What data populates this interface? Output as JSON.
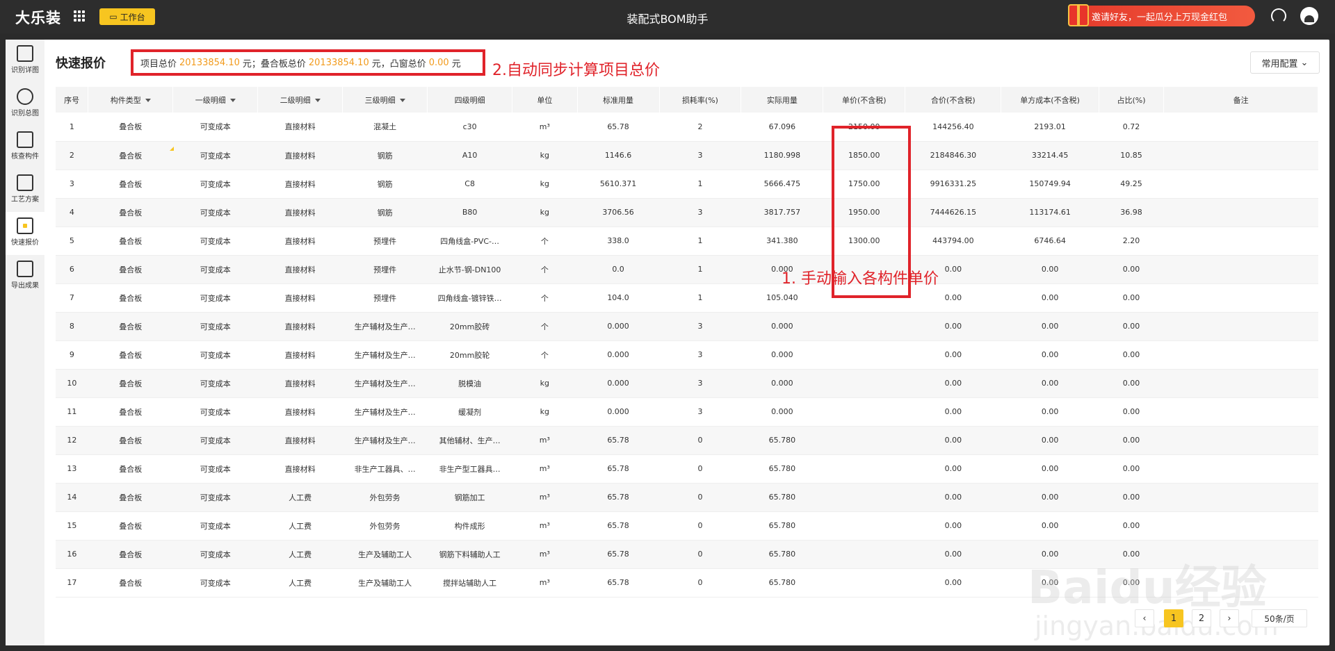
{
  "topbar": {
    "logo": "大乐装",
    "workbench_label": "工作台",
    "app_title": "装配式BOM助手",
    "invite_text": "邀请好友，一起瓜分上万现金红包"
  },
  "sidebar": {
    "items": [
      {
        "label": "识别详图"
      },
      {
        "label": "识别总图"
      },
      {
        "label": "核查构件"
      },
      {
        "label": "工艺方案"
      },
      {
        "label": "快速报价"
      },
      {
        "label": "导出成果"
      }
    ]
  },
  "header": {
    "title": "快速报价",
    "totals": {
      "project_label": "项目总价",
      "project_total": "20133854.10",
      "unit1": "元；叠合板总价",
      "slab_total": "20133854.10",
      "unit2": "元，凸窗总价",
      "window_total": "0.00",
      "unit3": "元"
    },
    "config_label": "常用配置"
  },
  "annotations": {
    "note_auto": "2.自动同步计算项目总价",
    "note_manual": "1. 手动输入各构件单价"
  },
  "table": {
    "columns": [
      "序号",
      "构件类型",
      "一级明细",
      "二级明细",
      "三级明细",
      "四级明细",
      "单位",
      "标准用量",
      "损耗率(%)",
      "实际用量",
      "单价(不含税)",
      "合价(不含税)",
      "单方成本(不含税)",
      "占比(%)",
      "备注"
    ],
    "rows": [
      [
        "1",
        "叠合板",
        "可变成本",
        "直接材料",
        "混凝土",
        "c30",
        "m³",
        "65.78",
        "2",
        "67.096",
        "2150.00",
        "144256.40",
        "2193.01",
        "0.72",
        ""
      ],
      [
        "2",
        "叠合板",
        "可变成本",
        "直接材料",
        "钢筋",
        "A10",
        "kg",
        "1146.6",
        "3",
        "1180.998",
        "1850.00",
        "2184846.30",
        "33214.45",
        "10.85",
        ""
      ],
      [
        "3",
        "叠合板",
        "可变成本",
        "直接材料",
        "钢筋",
        "C8",
        "kg",
        "5610.371",
        "1",
        "5666.475",
        "1750.00",
        "9916331.25",
        "150749.94",
        "49.25",
        ""
      ],
      [
        "4",
        "叠合板",
        "可变成本",
        "直接材料",
        "钢筋",
        "B80",
        "kg",
        "3706.56",
        "3",
        "3817.757",
        "1950.00",
        "7444626.15",
        "113174.61",
        "36.98",
        ""
      ],
      [
        "5",
        "叠合板",
        "可变成本",
        "直接材料",
        "预埋件",
        "四角线盒-PVC-…",
        "个",
        "338.0",
        "1",
        "341.380",
        "1300.00",
        "443794.00",
        "6746.64",
        "2.20",
        ""
      ],
      [
        "6",
        "叠合板",
        "可变成本",
        "直接材料",
        "预埋件",
        "止水节-钢-DN100",
        "个",
        "0.0",
        "1",
        "0.000",
        "",
        "0.00",
        "0.00",
        "0.00",
        ""
      ],
      [
        "7",
        "叠合板",
        "可变成本",
        "直接材料",
        "预埋件",
        "四角线盒-镀锌铁…",
        "个",
        "104.0",
        "1",
        "105.040",
        "",
        "0.00",
        "0.00",
        "0.00",
        ""
      ],
      [
        "8",
        "叠合板",
        "可变成本",
        "直接材料",
        "生产辅材及生产…",
        "20mm胶砖",
        "个",
        "0.000",
        "3",
        "0.000",
        "",
        "0.00",
        "0.00",
        "0.00",
        ""
      ],
      [
        "9",
        "叠合板",
        "可变成本",
        "直接材料",
        "生产辅材及生产…",
        "20mm胶轮",
        "个",
        "0.000",
        "3",
        "0.000",
        "",
        "0.00",
        "0.00",
        "0.00",
        ""
      ],
      [
        "10",
        "叠合板",
        "可变成本",
        "直接材料",
        "生产辅材及生产…",
        "脱模油",
        "kg",
        "0.000",
        "3",
        "0.000",
        "",
        "0.00",
        "0.00",
        "0.00",
        ""
      ],
      [
        "11",
        "叠合板",
        "可变成本",
        "直接材料",
        "生产辅材及生产…",
        "缓凝剂",
        "kg",
        "0.000",
        "3",
        "0.000",
        "",
        "0.00",
        "0.00",
        "0.00",
        ""
      ],
      [
        "12",
        "叠合板",
        "可变成本",
        "直接材料",
        "生产辅材及生产…",
        "其他辅材、生产…",
        "m³",
        "65.78",
        "0",
        "65.780",
        "",
        "0.00",
        "0.00",
        "0.00",
        ""
      ],
      [
        "13",
        "叠合板",
        "可变成本",
        "直接材料",
        "非生产工器具、…",
        "非生产型工器具…",
        "m³",
        "65.78",
        "0",
        "65.780",
        "",
        "0.00",
        "0.00",
        "0.00",
        ""
      ],
      [
        "14",
        "叠合板",
        "可变成本",
        "人工费",
        "外包劳务",
        "钢筋加工",
        "m³",
        "65.78",
        "0",
        "65.780",
        "",
        "0.00",
        "0.00",
        "0.00",
        ""
      ],
      [
        "15",
        "叠合板",
        "可变成本",
        "人工费",
        "外包劳务",
        "构件成形",
        "m³",
        "65.78",
        "0",
        "65.780",
        "",
        "0.00",
        "0.00",
        "0.00",
        ""
      ],
      [
        "16",
        "叠合板",
        "可变成本",
        "人工费",
        "生产及辅助工人",
        "钢筋下料辅助人工",
        "m³",
        "65.78",
        "0",
        "65.780",
        "",
        "0.00",
        "0.00",
        "0.00",
        ""
      ],
      [
        "17",
        "叠合板",
        "可变成本",
        "人工费",
        "生产及辅助工人",
        "搅拌站辅助人工",
        "m³",
        "65.78",
        "0",
        "65.780",
        "",
        "0.00",
        "0.00",
        "0.00",
        ""
      ]
    ]
  },
  "pagination": {
    "pages": [
      "1",
      "2"
    ],
    "current": "1",
    "page_size": "50条/页"
  },
  "watermark": {
    "text": "Baidu经验",
    "url": "jingyan.baidu.com"
  },
  "colors": {
    "accent": "#f7c520",
    "highlight_red": "#e0232a",
    "total_number": "#f29b1d"
  }
}
